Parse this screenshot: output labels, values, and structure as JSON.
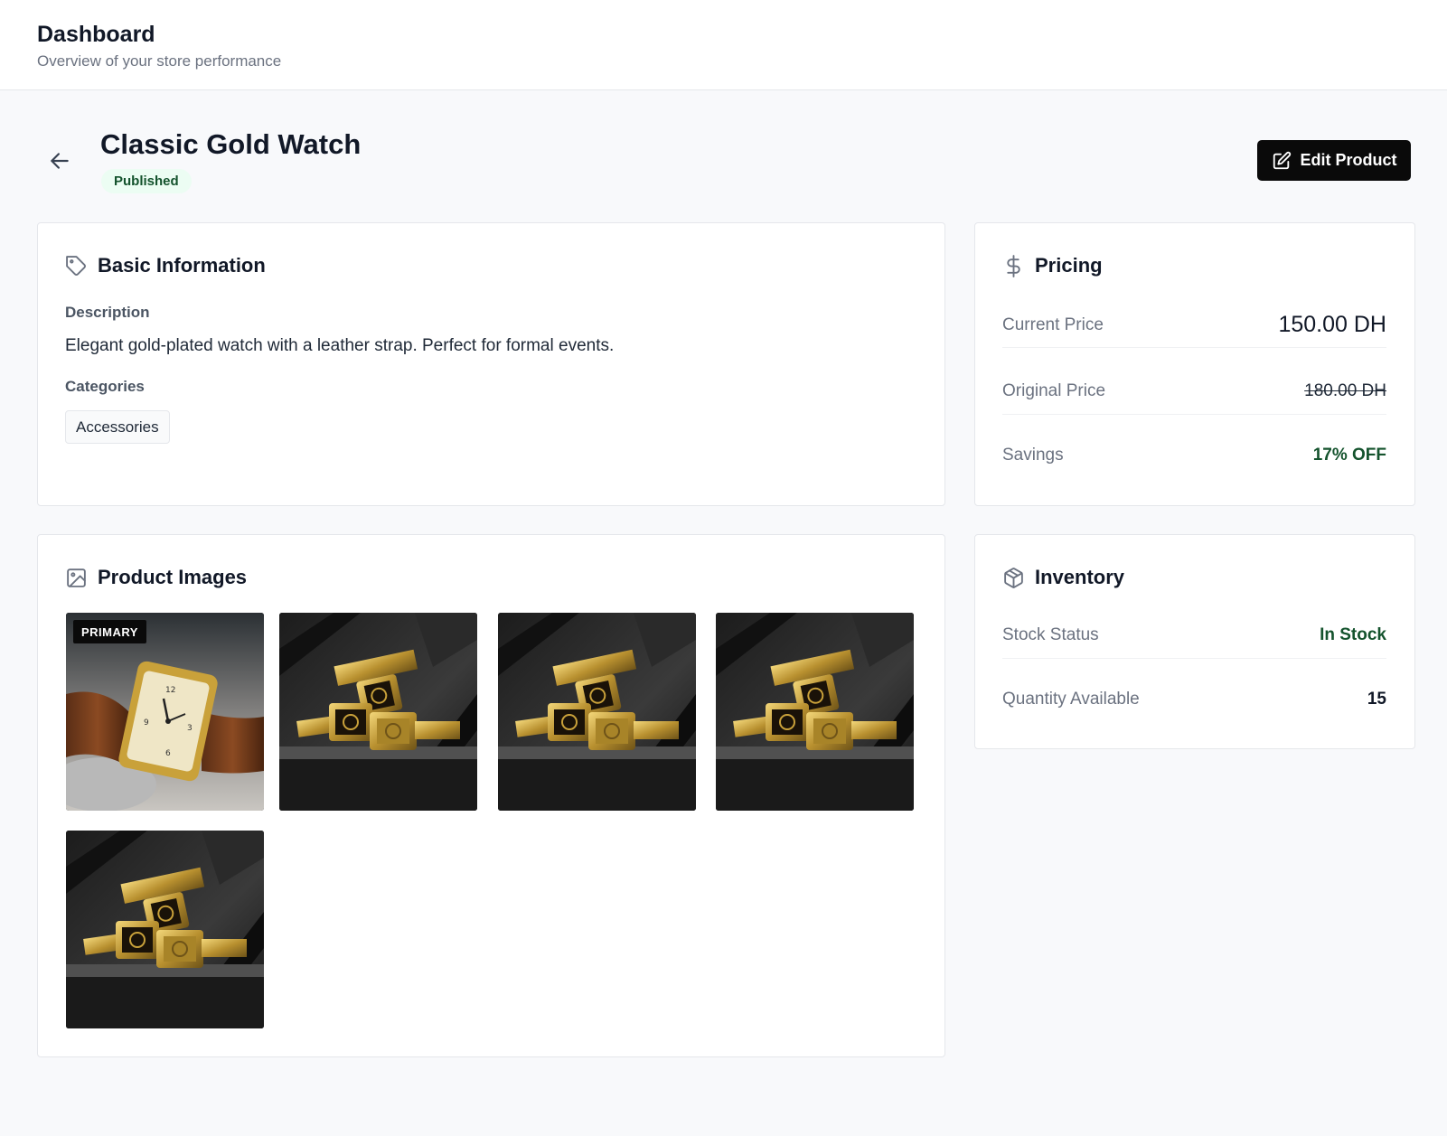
{
  "header": {
    "title": "Dashboard",
    "subtitle": "Overview of your store performance"
  },
  "product": {
    "name": "Classic Gold Watch",
    "status": "Published",
    "back_icon": "arrow-left-icon",
    "edit_label": "Edit Product",
    "edit_icon": "edit-icon"
  },
  "basic_info": {
    "title": "Basic Information",
    "icon": "tag-icon",
    "description_label": "Description",
    "description": "Elegant gold-plated watch with a leather strap. Perfect for formal events.",
    "categories_label": "Categories",
    "categories": [
      "Accessories"
    ]
  },
  "pricing": {
    "title": "Pricing",
    "icon": "dollar-icon",
    "rows": [
      {
        "label": "Current Price",
        "value": "150.00 DH"
      },
      {
        "label": "Original Price",
        "value": "180.00 DH"
      },
      {
        "label": "Savings",
        "value": "17% OFF"
      }
    ]
  },
  "images": {
    "title": "Product Images",
    "icon": "image-icon",
    "primary_label": "PRIMARY",
    "items": [
      {
        "kind": "leather-watch",
        "primary": true
      },
      {
        "kind": "gold-bracelet-watch",
        "primary": false
      },
      {
        "kind": "gold-bracelet-watch",
        "primary": false
      },
      {
        "kind": "gold-bracelet-watch",
        "primary": false
      },
      {
        "kind": "gold-bracelet-watch",
        "primary": false
      }
    ]
  },
  "inventory": {
    "title": "Inventory",
    "icon": "package-icon",
    "rows": [
      {
        "label": "Stock Status",
        "value": "In Stock"
      },
      {
        "label": "Quantity Available",
        "value": "15"
      }
    ]
  },
  "colors": {
    "accent_dark": "#0a0a0a",
    "success": "#14532d",
    "badge_bg": "#ecfdf3"
  }
}
